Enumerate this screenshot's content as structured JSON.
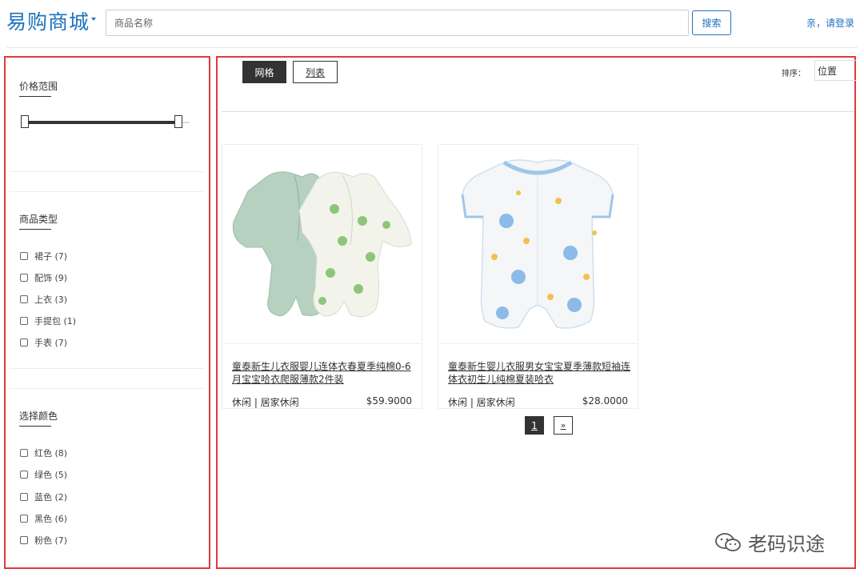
{
  "header": {
    "logo": "易购商城",
    "search_placeholder": "商品名称",
    "search_button": "搜索",
    "login": "亲，请登录"
  },
  "sidebar": {
    "price": {
      "title": "价格范围",
      "range_fraction": [
        0.0,
        1.0
      ]
    },
    "category": {
      "title": "商品类型",
      "items": [
        {
          "label": "裙子",
          "count": "(7)"
        },
        {
          "label": "配饰",
          "count": "(9)"
        },
        {
          "label": "上衣",
          "count": "(3)"
        },
        {
          "label": "手提包",
          "count": "(1)"
        },
        {
          "label": "手表",
          "count": "(7)"
        }
      ]
    },
    "color": {
      "title": "选择颜色",
      "items": [
        {
          "label": "红色",
          "count": "(8)"
        },
        {
          "label": "绿色",
          "count": "(5)"
        },
        {
          "label": "蓝色",
          "count": "(2)"
        },
        {
          "label": "黑色",
          "count": "(6)"
        },
        {
          "label": "粉色",
          "count": "(7)"
        }
      ]
    }
  },
  "toolbar": {
    "grid_label": "网格",
    "list_label": "列表",
    "sort_label": "排序：",
    "sort_value": "位置"
  },
  "products": [
    {
      "title": "童泰新生儿衣服婴儿连体衣春夏季纯棉0-6月宝宝哈衣爬服薄款2件装",
      "meta": "休闲 | 居家休闲",
      "price": "$59.9000"
    },
    {
      "title": "童泰新生婴儿衣服男女宝宝夏季薄款短袖连体衣初生儿纯棉夏装哈衣",
      "meta": "休闲 | 居家休闲",
      "price": "$28.0000"
    }
  ],
  "pagination": {
    "current": "1",
    "next": "»"
  },
  "watermark": "老码识途",
  "colors": {
    "accent": "#1e73be",
    "frame_red": "#e0393e",
    "dark": "#333333"
  }
}
